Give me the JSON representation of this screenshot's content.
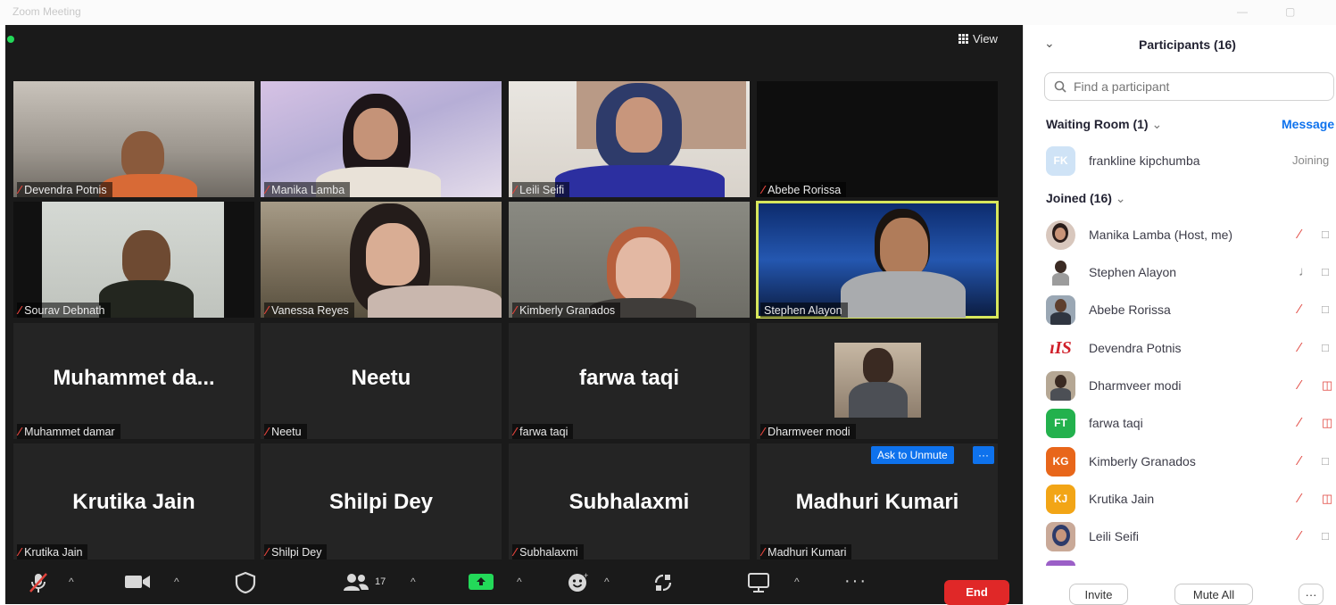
{
  "window": {
    "title": "Zoom Meeting"
  },
  "header": {
    "view_label": "View"
  },
  "tiles": [
    {
      "id": "devendra",
      "label": "Devendra Potnis"
    },
    {
      "id": "manika",
      "label": "Manika Lamba"
    },
    {
      "id": "leili",
      "label": "Leili Seifi"
    },
    {
      "id": "abebe",
      "label": "Abebe Rorissa"
    },
    {
      "id": "sourav",
      "label": "Sourav Debnath"
    },
    {
      "id": "vanessa",
      "label": "Vanessa Reyes"
    },
    {
      "id": "kimberly",
      "label": "Kimberly Granados"
    },
    {
      "id": "stephen",
      "label": "Stephen Alayon"
    },
    {
      "id": "muhammet",
      "label": "Muhammet damar",
      "display": "Muhammet  da..."
    },
    {
      "id": "neetu",
      "label": "Neetu",
      "display": "Neetu"
    },
    {
      "id": "farwa",
      "label": "farwa taqi",
      "display": "farwa taqi"
    },
    {
      "id": "dharmveer",
      "label": "Dharmveer modi"
    },
    {
      "id": "krutika",
      "label": "Krutika Jain",
      "display": "Krutika Jain"
    },
    {
      "id": "shilpi",
      "label": "Shilpi Dey",
      "display": "Shilpi Dey"
    },
    {
      "id": "subhalaxmi",
      "label": "Subhalaxmi",
      "display": "Subhalaxmi"
    },
    {
      "id": "madhuri",
      "label": "Madhuri Kumari",
      "display": "Madhuri Kumari"
    }
  ],
  "tile_actions": {
    "ask_to_unmute": "Ask to Unmute",
    "more": "···"
  },
  "toolbar": {
    "participants_count": "17",
    "end_label": "End"
  },
  "panel": {
    "title": "Participants (16)",
    "search_placeholder": "Find a participant",
    "waiting_room": {
      "label": "Waiting Room (1)",
      "message_label": "Message",
      "person": {
        "initials": "FK",
        "name": "frankline kipchumba",
        "status": "Joining"
      }
    },
    "joined_label": "Joined (16)",
    "participants": [
      {
        "name": "Manika Lamba (Host, me)",
        "initials": ""
      },
      {
        "name": "Stephen Alayon",
        "initials": ""
      },
      {
        "name": "Abebe Rorissa",
        "initials": ""
      },
      {
        "name": "Devendra Potnis",
        "initials": "ıIS"
      },
      {
        "name": "Dharmveer modi",
        "initials": ""
      },
      {
        "name": "farwa taqi",
        "initials": "FT"
      },
      {
        "name": "Kimberly Granados",
        "initials": "KG"
      },
      {
        "name": "Krutika Jain",
        "initials": "KJ"
      },
      {
        "name": "Leili Seifi",
        "initials": ""
      }
    ],
    "invite_label": "Invite",
    "mute_all_label": "Mute All",
    "more_label": "···"
  },
  "colors": {
    "accent": "#0e72ed",
    "end": "#e02828",
    "stage": "#1a1a1a",
    "speaking": "#d7e65c",
    "muted": "#e0433c",
    "ft_avatar": "#23b14d",
    "kg_avatar": "#e8661a",
    "kj_avatar": "#f2a516"
  }
}
